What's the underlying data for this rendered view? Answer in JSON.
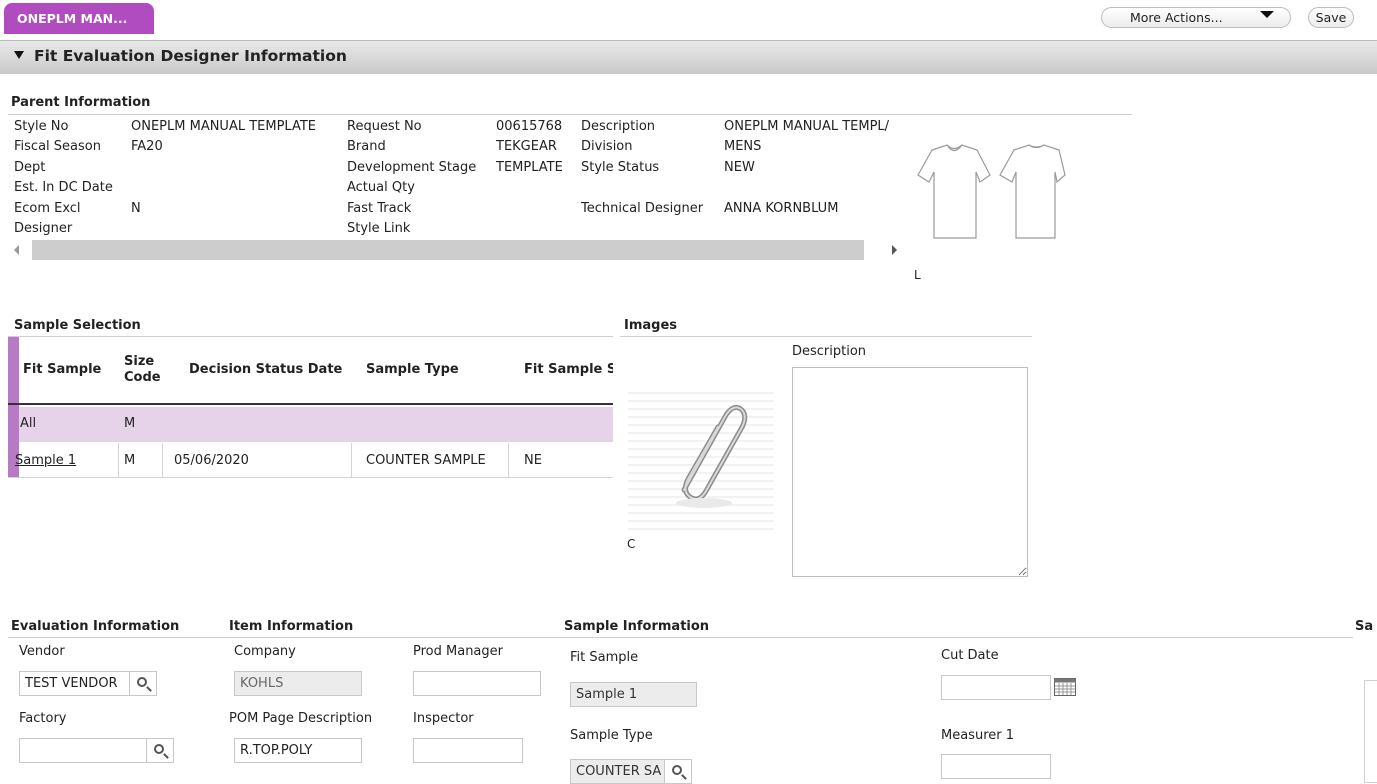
{
  "tab": {
    "label": "ONEPLM MAN..."
  },
  "toolbar": {
    "more_actions": "More Actions...",
    "save": "Save"
  },
  "section": {
    "title": "Fit Evaluation Designer Information"
  },
  "parent": {
    "title": "Parent Information",
    "col1": [
      {
        "label": "Style No",
        "value": "ONEPLM MANUAL TEMPLATE"
      },
      {
        "label": "Fiscal Season",
        "value": "FA20"
      },
      {
        "label": "Dept",
        "value": ""
      },
      {
        "label": "Est. In DC Date",
        "value": ""
      },
      {
        "label": "Ecom Excl",
        "value": "N"
      },
      {
        "label": "Designer",
        "value": ""
      }
    ],
    "col2": [
      {
        "label": "Request No",
        "value": "00615768"
      },
      {
        "label": "Brand",
        "value": "TEKGEAR"
      },
      {
        "label": "Development Stage",
        "value": "TEMPLATE"
      },
      {
        "label": "Actual Qty",
        "value": ""
      },
      {
        "label": "Fast Track",
        "value": ""
      },
      {
        "label": "Style Link",
        "value": ""
      }
    ],
    "col3": [
      {
        "label": "Description",
        "value": "ONEPLM MANUAL TEMPL/"
      },
      {
        "label": "Division",
        "value": "MENS"
      },
      {
        "label": "Style Status",
        "value": "NEW"
      },
      {
        "label": "",
        "value": ""
      },
      {
        "label": "Technical Designer",
        "value": "ANNA KORNBLUM"
      }
    ],
    "thumb_caption": "L"
  },
  "sample_selection": {
    "title": "Sample Selection",
    "headers": [
      "Fit Sample",
      "Size Code",
      "Decision Status Date",
      "Sample Type",
      "Fit Sample S"
    ],
    "rows": [
      {
        "fit_sample": "All",
        "size": "M",
        "date": "",
        "type": "",
        "status": ""
      },
      {
        "fit_sample": "Sample 1",
        "size": "M",
        "date": "05/06/2020",
        "type": "COUNTER SAMPLE",
        "status": "NE"
      }
    ]
  },
  "images": {
    "title": "Images",
    "description_label": "Description",
    "caption": "C"
  },
  "evaluation": {
    "title": "Evaluation Information",
    "vendor_label": "Vendor",
    "vendor_value": "TEST VENDOR",
    "factory_label": "Factory",
    "factory_value": ""
  },
  "item": {
    "title": "Item Information",
    "company_label": "Company",
    "company_value": "KOHLS",
    "prod_manager_label": "Prod Manager",
    "prod_manager_value": "",
    "pom_label": "POM Page Description",
    "pom_value": "R.TOP.POLY",
    "inspector_label": "Inspector",
    "inspector_value": ""
  },
  "sample_info": {
    "title": "Sample Information",
    "fit_sample_label": "Fit Sample",
    "fit_sample_value": "Sample 1",
    "sample_type_label": "Sample Type",
    "sample_type_value": "COUNTER SA",
    "cut_date_label": "Cut Date",
    "cut_date_value": "",
    "measurer_label": "Measurer 1",
    "measurer_value": ""
  },
  "right_edge": {
    "title_fragment": "Sa"
  }
}
